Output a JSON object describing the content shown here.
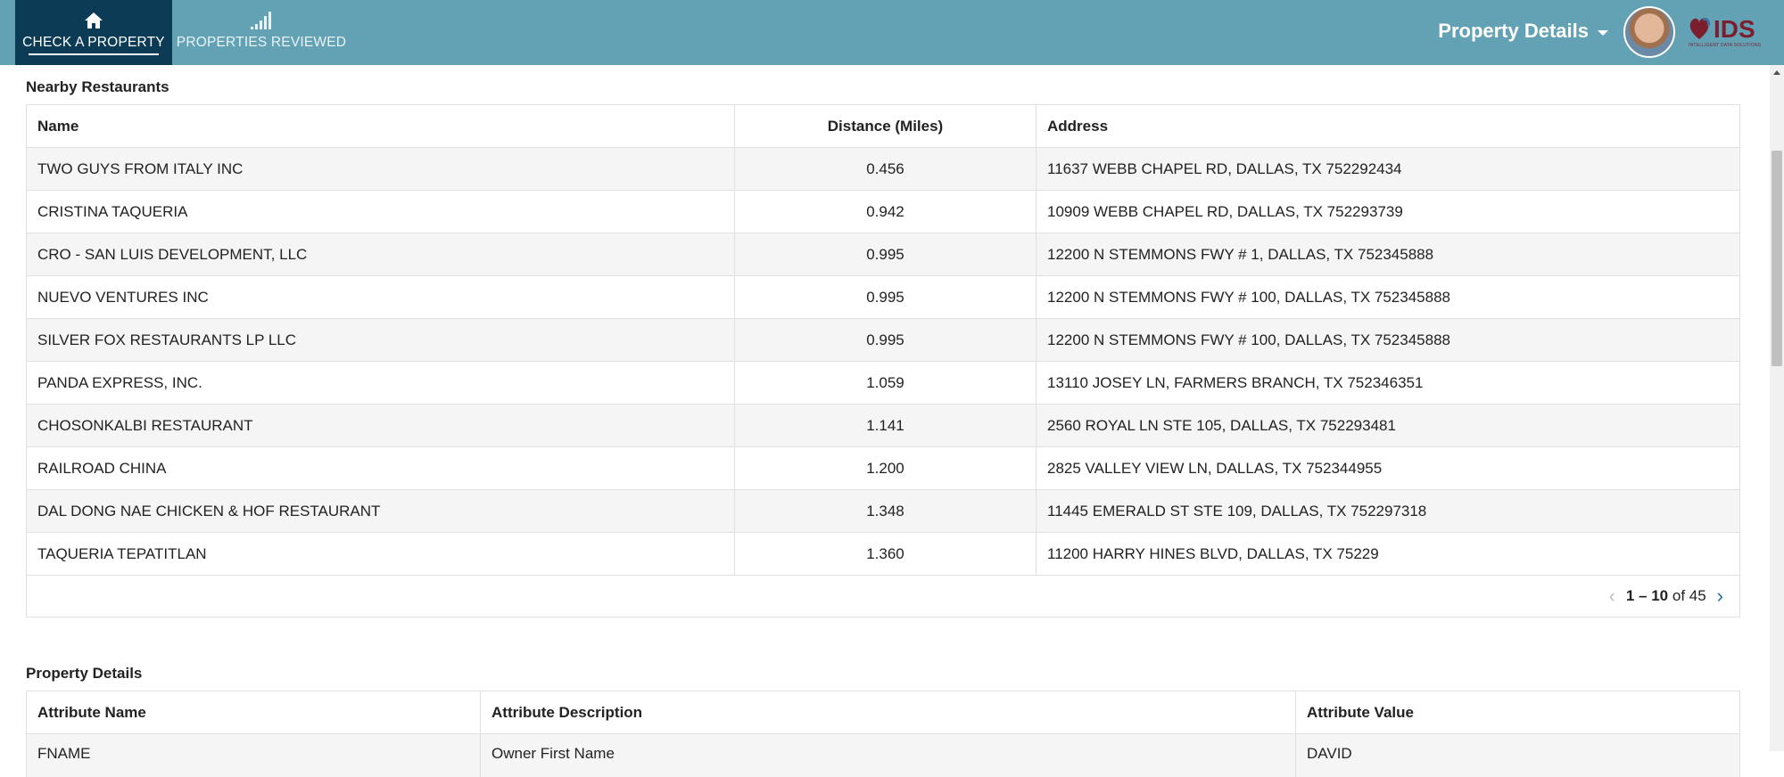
{
  "nav": {
    "check_label": "CHECK A PROPERTY",
    "reviewed_label": "PROPERTIES REVIEWED",
    "check_icon": "home-icon",
    "reviewed_icon": "signal-bars-icon"
  },
  "header": {
    "page_menu_label": "Property Details",
    "logo_text": "IDS",
    "logo_tagline": "INTELLIGENT DATA SOLUTIONS",
    "bg_color": "#62a2b4",
    "active_tab_color": "#0c3c55"
  },
  "restaurants": {
    "title": "Nearby Restaurants",
    "columns": [
      "Name",
      "Distance (Miles)",
      "Address"
    ],
    "rows": [
      {
        "name": "TWO GUYS FROM ITALY INC",
        "distance": "0.456",
        "address": "11637 WEBB CHAPEL RD, DALLAS, TX 752292434"
      },
      {
        "name": "CRISTINA TAQUERIA",
        "distance": "0.942",
        "address": "10909 WEBB CHAPEL RD, DALLAS, TX 752293739"
      },
      {
        "name": "CRO - SAN LUIS DEVELOPMENT, LLC",
        "distance": "0.995",
        "address": "12200 N STEMMONS FWY # 1, DALLAS, TX 752345888"
      },
      {
        "name": "NUEVO VENTURES INC",
        "distance": "0.995",
        "address": "12200 N STEMMONS FWY # 100, DALLAS, TX 752345888"
      },
      {
        "name": "SILVER FOX RESTAURANTS LP LLC",
        "distance": "0.995",
        "address": "12200 N STEMMONS FWY # 100, DALLAS, TX 752345888"
      },
      {
        "name": "PANDA EXPRESS, INC.",
        "distance": "1.059",
        "address": "13110 JOSEY LN, FARMERS BRANCH, TX 752346351"
      },
      {
        "name": "CHOSONKALBI RESTAURANT",
        "distance": "1.141",
        "address": "2560 ROYAL LN STE 105, DALLAS, TX 752293481"
      },
      {
        "name": "RAILROAD CHINA",
        "distance": "1.200",
        "address": "2825 VALLEY VIEW LN, DALLAS, TX 752344955"
      },
      {
        "name": "DAL DONG NAE CHICKEN & HOF RESTAURANT",
        "distance": "1.348",
        "address": "11445 EMERALD ST STE 109, DALLAS, TX 752297318"
      },
      {
        "name": "TAQUERIA TEPATITLAN",
        "distance": "1.360",
        "address": "11200 HARRY HINES BLVD, DALLAS, TX 75229"
      }
    ],
    "pager": {
      "range": "1 – 10",
      "of_label": "of 45"
    }
  },
  "property_details": {
    "title": "Property Details",
    "columns": [
      "Attribute Name",
      "Attribute Description",
      "Attribute Value"
    ],
    "partial_row": {
      "name": "FNAME",
      "description": "Owner First Name",
      "value": "DAVID"
    }
  }
}
